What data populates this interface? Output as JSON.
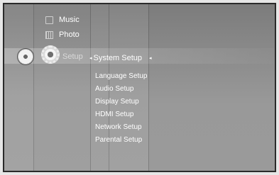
{
  "menu": {
    "music_label": "Music",
    "photo_label": "Photo",
    "setup_label": "Setup"
  },
  "system_setup": {
    "label": "System Setup",
    "items": [
      "Language Setup",
      "Audio Setup",
      "Display Setup",
      "HDMI Setup",
      "Network Setup",
      "Parental Setup"
    ]
  },
  "icons": {
    "music": "music-note-icon",
    "photo": "photo-icon",
    "disc": "disc-icon",
    "setup": "gear-icon",
    "left_arrow": "chevron-left-icon",
    "right_arrow": "chevron-right-icon"
  },
  "colors": {
    "text": "#ffffff",
    "setup_text": "#d9d9d9",
    "border": "#2a2a2a"
  }
}
